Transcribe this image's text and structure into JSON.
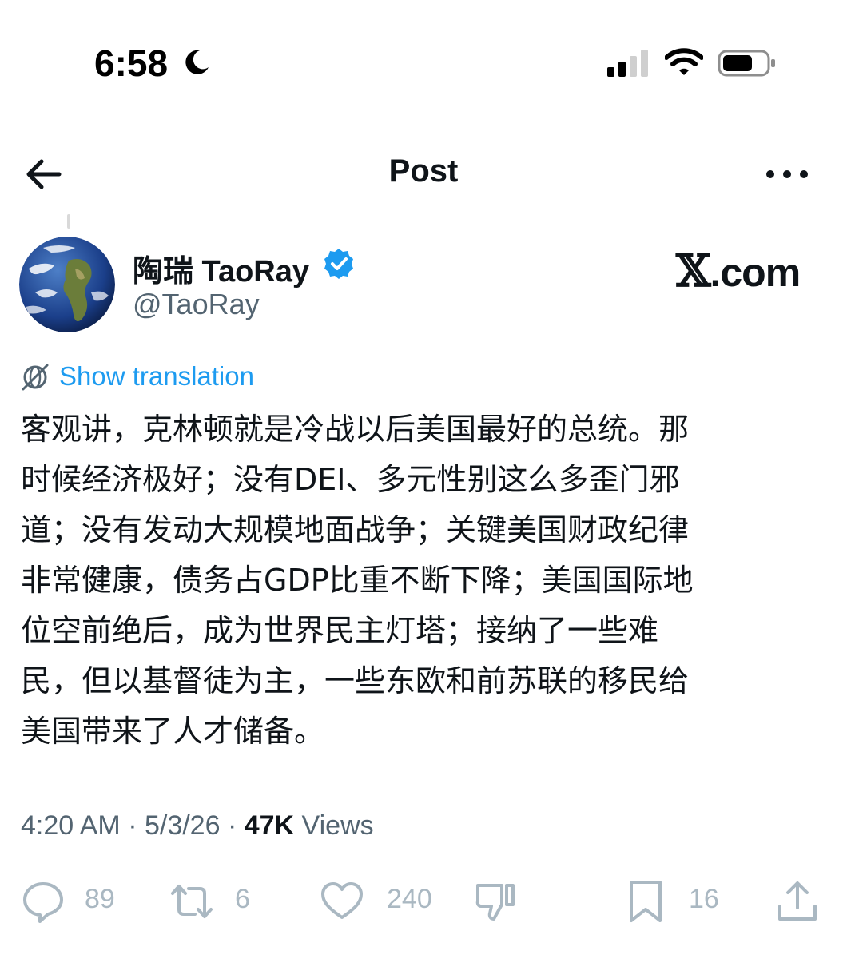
{
  "status_bar": {
    "time": "6:58",
    "icons": [
      "moon-icon",
      "cellular-signal-icon",
      "wifi-icon",
      "battery-icon"
    ]
  },
  "header": {
    "title": "Post",
    "icons": [
      "back-arrow-icon",
      "more-options-icon"
    ]
  },
  "author": {
    "display_name": "陶瑞 TaoRay",
    "handle": "@TaoRay",
    "verified": true,
    "avatar": "earth-globe-image"
  },
  "watermark": {
    "x_glyph": "𝕏",
    "domain": ".com"
  },
  "translation": {
    "label": "Show translation",
    "icon": "globe-slash-icon"
  },
  "tweet": {
    "lines": [
      "客观讲，克林顿就是冷战以后美国最好的总统。那",
      "时候经济极好；没有DEI、多元性别这么多歪门邪",
      "道；没有发动大规模地面战争；关键美国财政纪律",
      "非常健康，债务占GDP比重不断下降；美国国际地",
      "位空前绝后，成为世界民主灯塔；接纳了一些难",
      "民，但以基督徒为主，一些东欧和前苏联的移民给",
      "美国带来了人才储备。"
    ]
  },
  "meta": {
    "time": "4:20 AM",
    "sep1": " · ",
    "date": "5/3/26",
    "sep2": " · ",
    "views_count": "47K",
    "views_label": " Views"
  },
  "actions": {
    "replies": "89",
    "reposts": "6",
    "likes": "240",
    "bookmarks": "16"
  },
  "colors": {
    "accent": "#1d9bf0",
    "secondary_text": "#536471",
    "action_icons": "#aab8c2"
  }
}
